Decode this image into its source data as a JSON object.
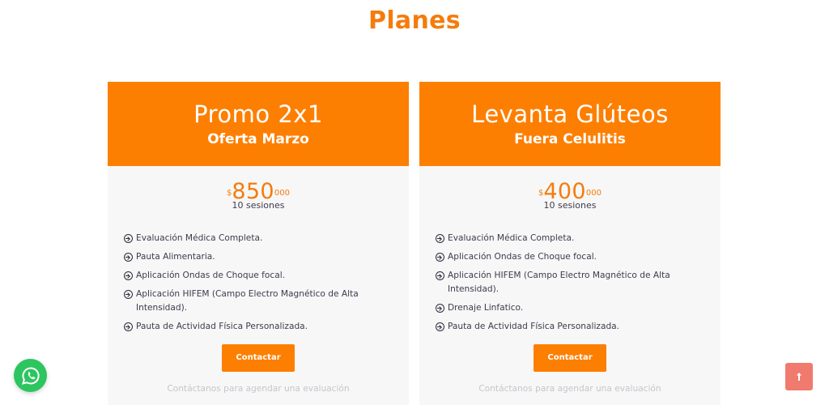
{
  "section": {
    "title": "Planes"
  },
  "plans": [
    {
      "title": "Promo 2x1",
      "subtitle": "Oferta Marzo",
      "price": {
        "currency": "$",
        "amount": "850",
        "cents": "000",
        "sessions": "10 sesiones"
      },
      "features": [
        "Evaluación Médica Completa.",
        "Pauta Alimentaria.",
        "Aplicación Ondas de Choque focal.",
        "Aplicación HIFEM (Campo Electro Magnético de Alta Intensidad).",
        "Pauta de Actividad Física Personalizada."
      ],
      "button_label": "Contactar",
      "note": "Contáctanos para agendar una evaluación"
    },
    {
      "title": "Levanta Glúteos",
      "subtitle": "Fuera Celulitis",
      "price": {
        "currency": "$",
        "amount": "400",
        "cents": "000",
        "sessions": "10 sesiones"
      },
      "features": [
        "Evaluación Médica Completa.",
        "Aplicación Ondas de Choque focal.",
        "Aplicación HIFEM (Campo Electro Magnético de Alta Intensidad).",
        "Drenaje Linfatico.",
        "Pauta de Actividad Física Personalizada."
      ],
      "button_label": "Contactar",
      "note": "Contáctanos para agendar una evaluación"
    }
  ],
  "floating": {
    "whatsapp_icon": "whatsapp-icon",
    "scroll_top_icon": "arrow-up-icon"
  },
  "colors": {
    "accent": "#fd7f02",
    "title": "#f47c0d",
    "card_bg": "#f7f7f7",
    "whatsapp": "#2dc55f",
    "scroll_top": "#f17a6f"
  }
}
